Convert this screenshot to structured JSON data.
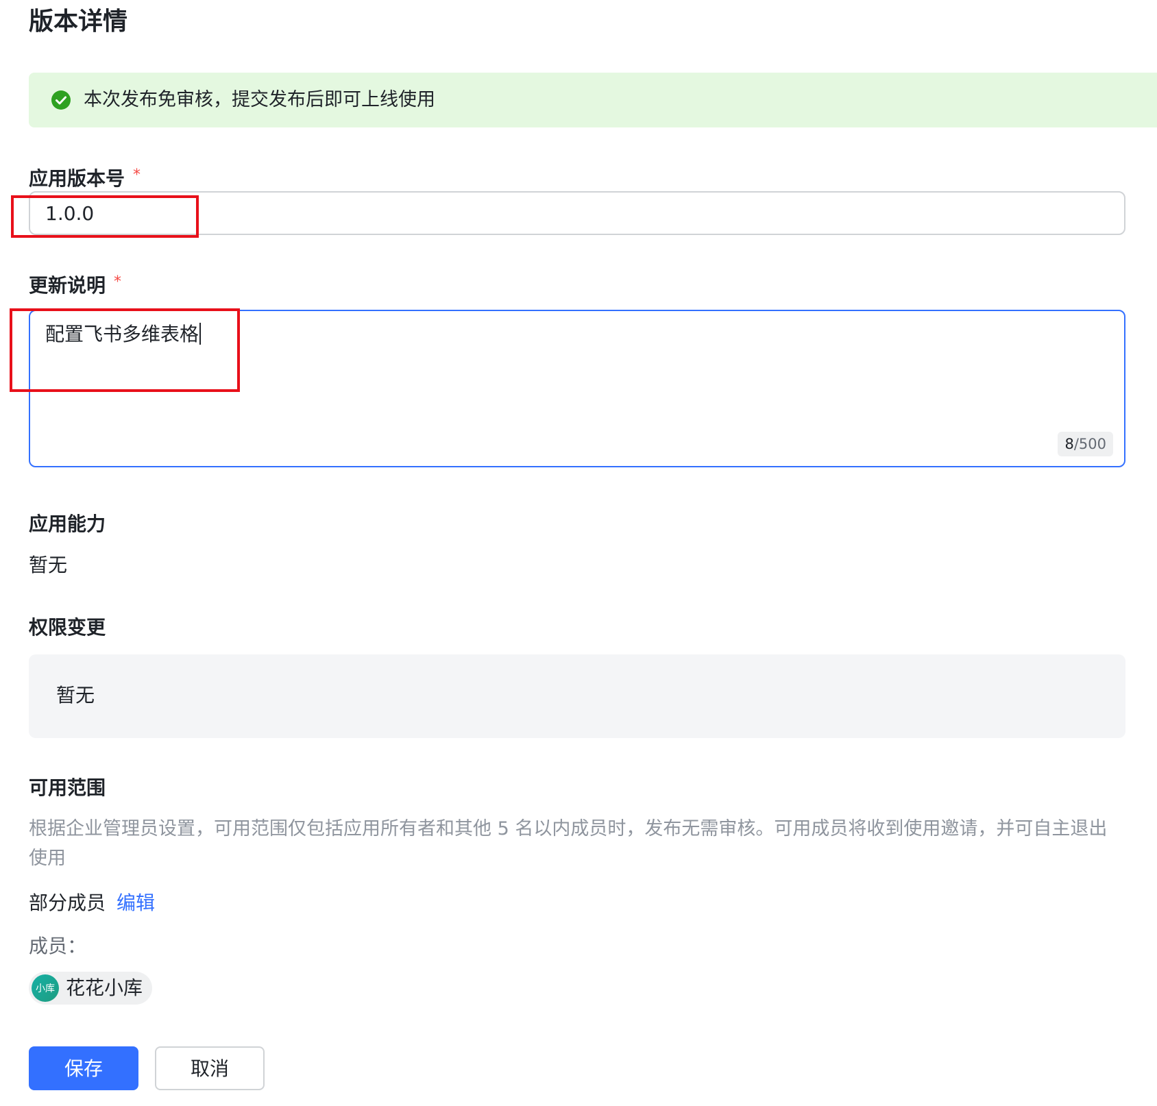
{
  "page": {
    "title": "版本详情"
  },
  "notice": {
    "icon": "check-circle-icon",
    "text": "本次发布免审核，提交发布后即可上线使用",
    "color": "#e4f8e0"
  },
  "version": {
    "label": "应用版本号",
    "required_mark": "*",
    "value": "1.0.0"
  },
  "release_notes": {
    "label": "更新说明",
    "required_mark": "*",
    "value": "配置飞书多维表格",
    "count": "8",
    "max": "/500"
  },
  "capabilities": {
    "label": "应用能力",
    "value": "暂无"
  },
  "permissions": {
    "label": "权限变更",
    "value": "暂无"
  },
  "scope": {
    "label": "可用范围",
    "description": "根据企业管理员设置，可用范围仅包括应用所有者和其他 5 名以内成员时，发布无需审核。可用成员将收到使用邀请，并可自主退出使用",
    "mode": "部分成员",
    "edit_label": "编辑",
    "members_label": "成员：",
    "members": [
      {
        "avatar_text": "小库",
        "name": "花花小库"
      }
    ]
  },
  "actions": {
    "save_label": "保存",
    "cancel_label": "取消"
  },
  "colors": {
    "accent": "#3370ff",
    "required": "#f54a45",
    "highlight": "#e8101a"
  }
}
